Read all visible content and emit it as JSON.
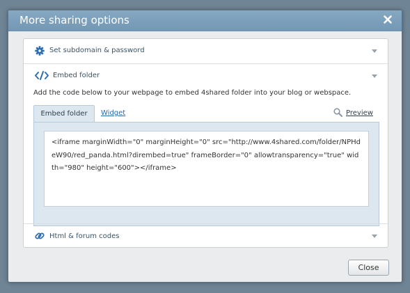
{
  "dialog": {
    "title": "More sharing options",
    "close_icon": "close-icon"
  },
  "sections": {
    "subdomain": {
      "label": "Set subdomain & password",
      "icon": "gear-icon",
      "expanded": false
    },
    "embed": {
      "label": "Embed folder",
      "icon": "code-icon",
      "expanded": true
    },
    "html_forum": {
      "label": "Html & forum codes",
      "icon": "link-icon",
      "expanded": false
    }
  },
  "embed": {
    "description": "Add the code below to your webpage to embed 4shared folder into your blog or webspace.",
    "tabs": {
      "embed_folder": "Embed folder",
      "widget": "Widget",
      "active": "Embed folder"
    },
    "preview_label": "Preview",
    "preview_icon": "magnifier-icon",
    "code": "<iframe marginWidth=\"0\" marginHeight=\"0\" src=\"http://www.4shared.com/folder/NPHdeW90/red_panda.html?dirembed=true\" frameBorder=\"0\" allowtransparency=\"true\" width=\"980\" height=\"600\"></iframe>"
  },
  "buttons": {
    "close_label": "Close"
  },
  "colors": {
    "titlebar": "#7a9db9",
    "link": "#2a6aa8",
    "icon_blue": "#2f6fb0"
  }
}
